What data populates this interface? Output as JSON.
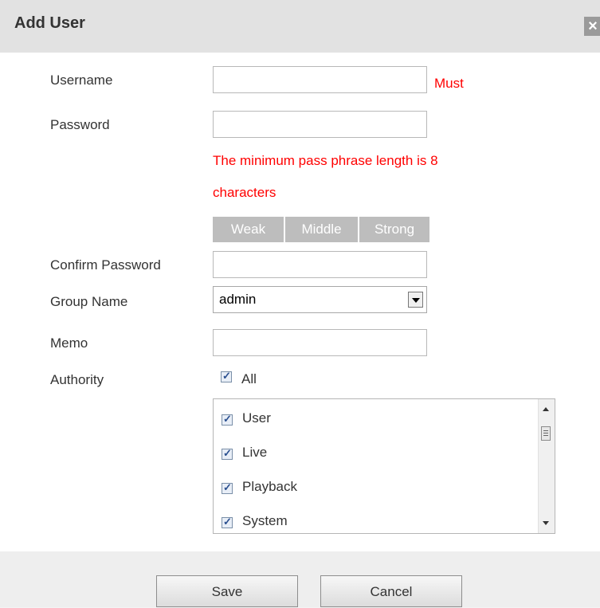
{
  "dialog": {
    "title": "Add User",
    "close_glyph": "×"
  },
  "form": {
    "username": {
      "label": "Username",
      "value": "",
      "required_note": "Must"
    },
    "password": {
      "label": "Password",
      "value": "",
      "hint_line1": "The minimum pass phrase length is 8",
      "hint_line2": "characters",
      "strength": [
        "Weak",
        "Middle",
        "Strong"
      ]
    },
    "confirm_password": {
      "label": "Confirm Password",
      "value": ""
    },
    "group_name": {
      "label": "Group Name",
      "selected": "admin"
    },
    "memo": {
      "label": "Memo",
      "value": ""
    },
    "authority": {
      "label": "Authority",
      "all_label": "All",
      "all_checked": true,
      "items": [
        {
          "label": "User",
          "checked": true
        },
        {
          "label": "Live",
          "checked": true
        },
        {
          "label": "Playback",
          "checked": true
        },
        {
          "label": "System",
          "checked": true
        }
      ]
    }
  },
  "footer": {
    "save_label": "Save",
    "cancel_label": "Cancel"
  },
  "icons": {
    "close": "close-icon",
    "dropdown": "chevron-down-icon",
    "check": "checkmark-icon"
  },
  "colors": {
    "warning": "#ff0000",
    "titlebar": "#e2e2e2",
    "strength_bar": "#bdbdbd"
  }
}
